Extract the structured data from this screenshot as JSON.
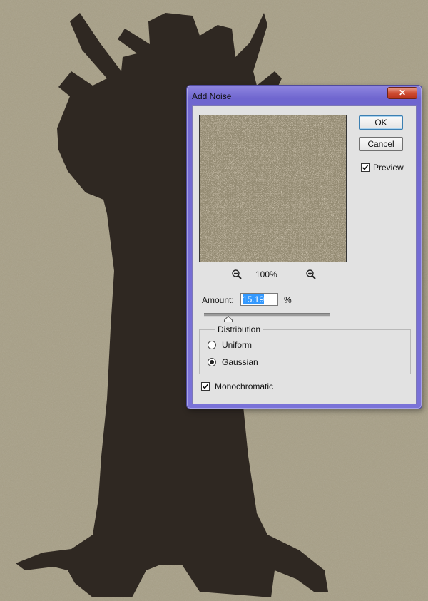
{
  "dialog": {
    "title": "Add Noise",
    "close_glyph": "✕",
    "ok_label": "OK",
    "cancel_label": "Cancel",
    "preview_label": "Preview",
    "preview_checked": true,
    "zoom_level": "100%",
    "amount_label": "Amount:",
    "amount_value": "15.19",
    "amount_unit": "%",
    "amount_slider_fraction": 0.19,
    "distribution": {
      "title": "Distribution",
      "options": [
        "Uniform",
        "Gaussian"
      ],
      "selected": "Gaussian"
    },
    "monochromatic_label": "Monochromatic",
    "monochromatic_checked": true
  },
  "colors": {
    "canvas_background": "#a79f86",
    "tree_silhouette": "#2f2822",
    "dialog_frame": "#7a72d8",
    "dialog_client": "#e2e2e2",
    "close_button": "#cf4d33",
    "selection": "#3399ff"
  },
  "icons": [
    "zoom-out-icon",
    "zoom-in-icon",
    "close-icon",
    "checkmark-icon",
    "slider-thumb-icon"
  ]
}
